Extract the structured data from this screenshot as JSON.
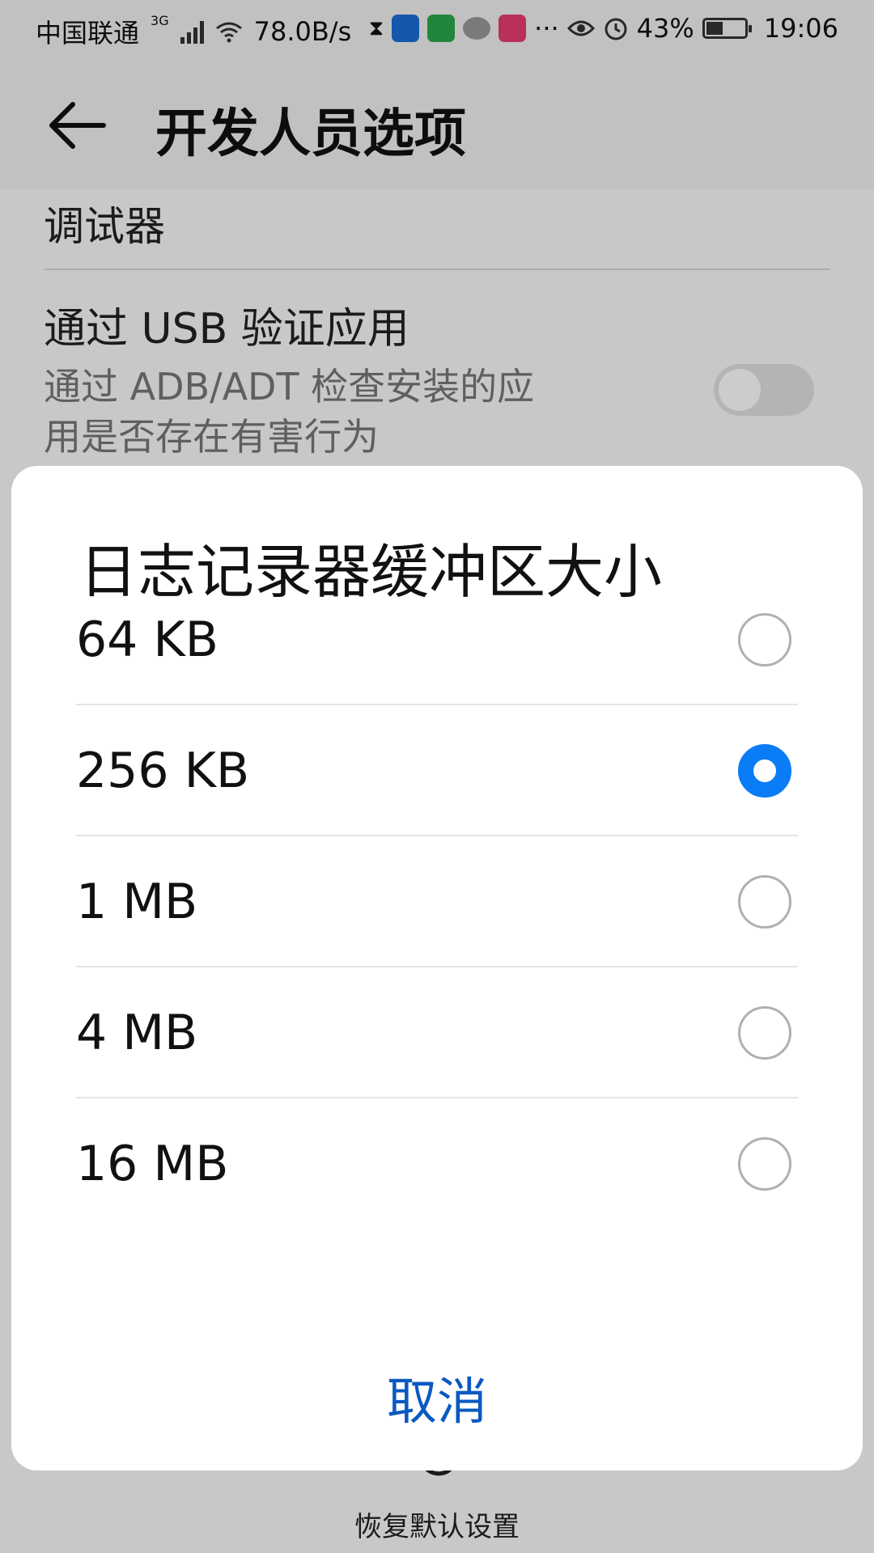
{
  "status_bar": {
    "carrier": "中国联通",
    "network_type": "3G",
    "speed": "78.0B/s",
    "battery_percent": "43%",
    "battery_level": 0.43,
    "time": "19:06",
    "icons": [
      "signal-icon",
      "wifi-icon",
      "hourglass-icon",
      "shield-app-icon",
      "green-app-icon",
      "chat-bubble-icon",
      "video-app-icon",
      "more-dots-icon",
      "eye-icon",
      "alarm-icon",
      "battery-icon"
    ],
    "more": "···"
  },
  "app_bar": {
    "title": "开发人员选项"
  },
  "settings": {
    "partial_item_title": "调试器",
    "usb_verify": {
      "title": "通过 USB 验证应用",
      "summary_line1": "通过 ADB/ADT 检查安装的应",
      "summary_line2": "用是否存在有害行为",
      "enabled": false
    }
  },
  "bottom_bar": {
    "restore_label": "恢复默认设置"
  },
  "dialog": {
    "title": "日志记录器缓冲区大小",
    "options": [
      {
        "label": "64 KB",
        "selected": false
      },
      {
        "label": "256 KB",
        "selected": true
      },
      {
        "label": "1 MB",
        "selected": false
      },
      {
        "label": "4 MB",
        "selected": false
      },
      {
        "label": "16 MB",
        "selected": false
      }
    ],
    "cancel_label": "取消"
  },
  "colors": {
    "accent": "#0a7cf5",
    "cancel_text": "#0a59c2"
  }
}
